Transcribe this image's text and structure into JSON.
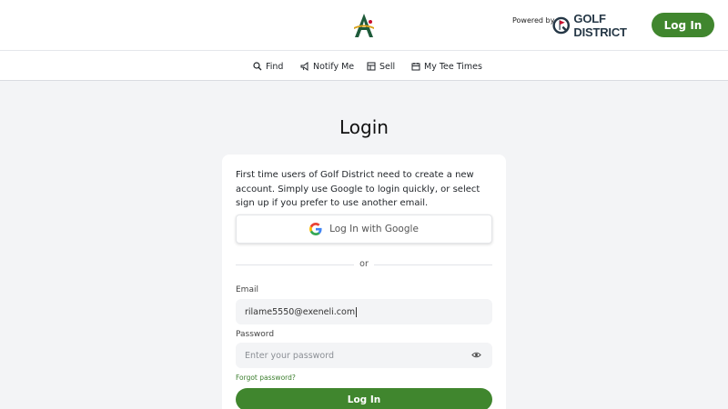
{
  "header": {
    "powered_by": "Powered by",
    "brand": "GOLF DISTRICT",
    "login_label": "Log In"
  },
  "nav": [
    {
      "label": "Find",
      "icon": "search-icon"
    },
    {
      "label": "Notify Me",
      "icon": "megaphone-icon"
    },
    {
      "label": "Sell",
      "icon": "sell-icon"
    },
    {
      "label": "My Tee Times",
      "icon": "calendar-icon"
    }
  ],
  "login": {
    "title": "Login",
    "intro": "First time users of Golf District need to create a new account. Simply use Google to login quickly, or select sign up if you prefer to use another email.",
    "google_label": "Log In with Google",
    "or_label": "or",
    "email_label": "Email",
    "email_value": "rilame5550@exeneli.com",
    "password_label": "Password",
    "password_placeholder": "Enter your password",
    "forgot_label": "Forgot password?",
    "submit_label": "Log In"
  },
  "colors": {
    "accent": "#40862e",
    "brand_navy": "#253746",
    "brand_red": "#c8102e"
  }
}
